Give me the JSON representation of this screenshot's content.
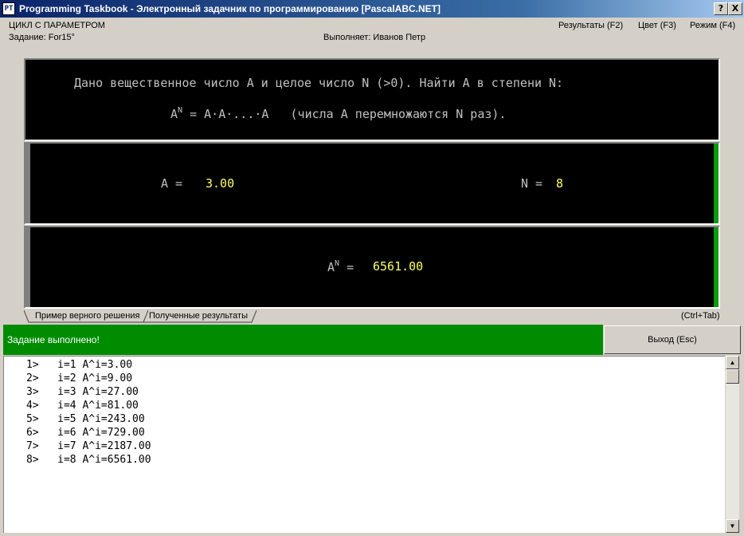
{
  "window": {
    "icon_label": "PT",
    "title": "Programming Taskbook - Электронный задачник по программированию [PascalABC.NET]",
    "help_button": "?",
    "close_button": "X"
  },
  "header": {
    "group": "ЦИКЛ С ПАРАМЕТРОМ",
    "task": "Задание: For15°",
    "performer": "Выполняет: Иванов Петр",
    "menu": [
      "Результаты (F2)",
      "Цвет (F3)",
      "Режим (F4)"
    ]
  },
  "task_panel": {
    "line1": "Дано вещественное число A и целое число N (>0). Найти A в степени N:",
    "line2_base": "A",
    "line2_sup": "N",
    "line2_rest": " = A·A·...·A   (числа A перемножаются N раз)."
  },
  "input_panel": {
    "a_label": "A =",
    "a_value": "3.00",
    "n_label": "N =",
    "n_value": "8"
  },
  "output_panel": {
    "label_base": "A",
    "label_sup": "N",
    "label_eq": " =",
    "value": "6561.00"
  },
  "tabs": {
    "items": [
      "Пример верного решения",
      "Полученные результаты"
    ],
    "shortcut": "(Ctrl+Tab)"
  },
  "status": {
    "message": "Задание выполнено!",
    "exit_label": "Выход (Esc)"
  },
  "log": [
    "1>   i=1 A^i=3.00",
    "2>   i=2 A^i=9.00",
    "3>   i=3 A^i=27.00",
    "4>   i=4 A^i=81.00",
    "5>   i=5 A^i=243.00",
    "6>   i=6 A^i=729.00",
    "7>   i=7 A^i=2187.00",
    "8>   i=8 A^i=6561.00"
  ],
  "scrollbar": {
    "up_glyph": "▲",
    "down_glyph": "▼"
  },
  "colors": {
    "title_bar": "#0a246a",
    "panel_background": "#000000",
    "panel_text": "#c0c0c0",
    "value_text": "#ffff66",
    "success": "#008c00"
  }
}
